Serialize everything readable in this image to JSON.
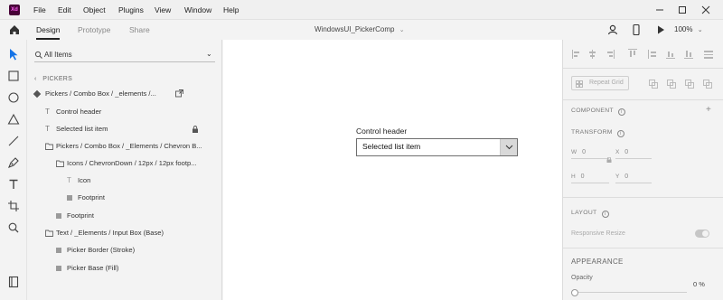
{
  "app": {
    "logo_text": "Xd"
  },
  "menu": {
    "items": [
      "File",
      "Edit",
      "Object",
      "Plugins",
      "View",
      "Window",
      "Help"
    ]
  },
  "tabs": {
    "items": [
      "Design",
      "Prototype",
      "Share"
    ],
    "active": "Design"
  },
  "document": {
    "title": "WindowsUI_PickerComp"
  },
  "zoom": "100%",
  "layers": {
    "filter_label": "All Items",
    "breadcrumb": "PICKERS",
    "component_name": "Pickers / Combo Box / _elements /...",
    "rows": [
      {
        "label": "Control header"
      },
      {
        "label": "Selected list item"
      },
      {
        "label": "Pickers / Combo Box / _Elements / Chevron B..."
      },
      {
        "label": "Icons / ChevronDown / 12px / 12px footp..."
      },
      {
        "label": "Icon"
      },
      {
        "label": "Footprint"
      },
      {
        "label": "Footprint"
      },
      {
        "label": "Text / _Elements / Input Box (Base)"
      },
      {
        "label": "Picker Border (Stroke)"
      },
      {
        "label": "Picker Base (Fill)"
      }
    ]
  },
  "canvas": {
    "combo_header": "Control header",
    "combo_value": "Selected list item"
  },
  "inspector": {
    "repeat_grid": "Repeat Grid",
    "component": "COMPONENT",
    "transform": "TRANSFORM",
    "w_label": "W",
    "w_value": "0",
    "x_label": "X",
    "x_value": "0",
    "h_label": "H",
    "h_value": "0",
    "y_label": "Y",
    "y_value": "0",
    "layout": "LAYOUT",
    "responsive_resize": "Responsive Resize",
    "appearance": "APPEARANCE",
    "opacity_label": "Opacity",
    "opacity_value": "0 %"
  },
  "colors": {
    "accent": "#1473e6",
    "logo_bg": "#470137",
    "logo_fg": "#ff61f6"
  }
}
